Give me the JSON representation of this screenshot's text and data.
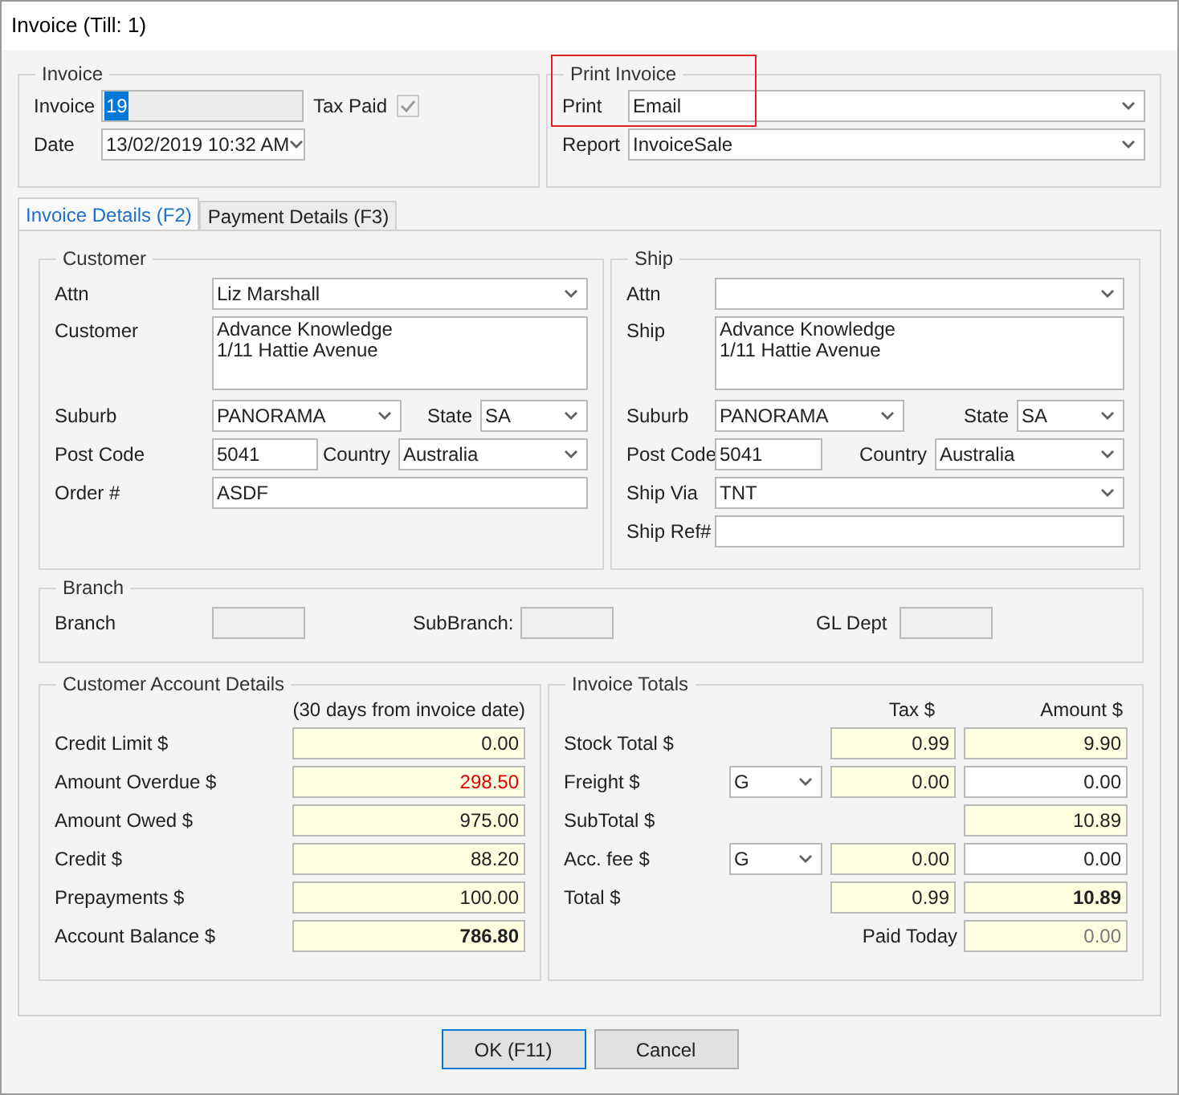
{
  "window": {
    "title": "Invoice (Till: 1)"
  },
  "invoice_group": {
    "title": "Invoice",
    "invoice_label": "Invoice",
    "invoice_value": "19",
    "invoice_value_selected": true,
    "tax_paid_label": "Tax Paid",
    "tax_paid_checked": true,
    "tax_paid_disabled": true,
    "date_label": "Date",
    "date_value": "13/02/2019 10:32 AM"
  },
  "print_group": {
    "title": "Print Invoice",
    "highlighted": true,
    "print_label": "Print",
    "print_value": "Email",
    "report_label": "Report",
    "report_value": "InvoiceSale"
  },
  "tabs": [
    {
      "label": "Invoice Details (F2)",
      "selected": true
    },
    {
      "label": "Payment Details (F3)",
      "selected": false
    }
  ],
  "customer": {
    "title": "Customer",
    "attn_label": "Attn",
    "attn_value": "Liz Marshall",
    "address_label": "Customer",
    "address_lines": [
      "Advance Knowledge",
      "1/11 Hattie Avenue"
    ],
    "suburb_label": "Suburb",
    "suburb_value": "PANORAMA",
    "state_label": "State",
    "state_value": "SA",
    "post_code_label": "Post Code",
    "post_code_value": "5041",
    "country_label": "Country",
    "country_value": "Australia",
    "order_label": "Order #",
    "order_value": "ASDF"
  },
  "ship": {
    "title": "Ship",
    "attn_label": "Attn",
    "address_label": "Ship",
    "address_lines": [
      "Advance Knowledge",
      "1/11 Hattie Avenue"
    ],
    "suburb_label": "Suburb",
    "suburb_value": "PANORAMA",
    "state_label": "State",
    "state_value": "SA",
    "post_code_label": "Post Code",
    "post_code_value": "5041",
    "country_label": "Country",
    "country_value": "Australia",
    "ship_via_label": "Ship Via",
    "ship_via_value": "TNT",
    "ship_ref_label": "Ship Ref#"
  },
  "branch": {
    "title": "Branch",
    "fields": [
      "Branch",
      "SubBranch:",
      "GL Dept"
    ]
  },
  "account": {
    "title": "Customer Account Details",
    "note": "(30 days from invoice date)",
    "rows": [
      {
        "label": "Credit Limit $",
        "value": "0.00",
        "kind": "normal"
      },
      {
        "label": "Amount Overdue $",
        "value": "298.50",
        "kind": "overdue"
      },
      {
        "label": "Amount Owed $",
        "value": "975.00",
        "kind": "normal"
      },
      {
        "label": "Credit $",
        "value": "88.20",
        "kind": "normal"
      },
      {
        "label": "Prepayments $",
        "value": "100.00",
        "kind": "normal"
      },
      {
        "label": "Account Balance $",
        "value": "786.80",
        "kind": "total"
      }
    ]
  },
  "totals": {
    "title": "Invoice Totals",
    "tax_header": "Tax $",
    "amount_header": "Amount $",
    "rows": [
      {
        "kind": "line",
        "label": "Stock Total $",
        "tax": "0.99",
        "amount": "9.90"
      },
      {
        "kind": "coded",
        "label": "Freight $",
        "code": "G",
        "tax": "0.00",
        "amount": "0.00"
      },
      {
        "kind": "subtotal",
        "label": "SubTotal $",
        "amount": "10.89"
      },
      {
        "kind": "coded",
        "label": "Acc. fee $",
        "code": "G",
        "tax": "0.00",
        "amount": "0.00"
      },
      {
        "kind": "total",
        "label": "Total $",
        "tax": "0.99",
        "amount": "10.89"
      },
      {
        "kind": "paid",
        "label": "Paid Today",
        "amount": "0.00"
      }
    ]
  },
  "buttons": [
    {
      "label": "OK (F11)",
      "default": true
    },
    {
      "label": "Cancel",
      "default": false
    }
  ]
}
